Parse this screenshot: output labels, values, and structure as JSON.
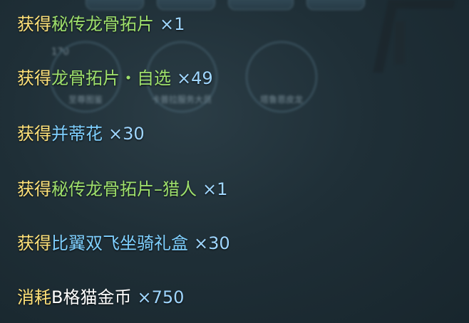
{
  "colors": {
    "verb": "#ffe27a",
    "item_green": "#9ee06c",
    "item_blue": "#7fd0ff",
    "quantity": "#9fd6ff"
  },
  "background": {
    "level_text": "170",
    "slots": [
      {
        "caption": "至尊图鉴"
      },
      {
        "caption": "卡普拉服务大员"
      },
      {
        "caption": "塔鲁恩皮龙"
      }
    ]
  },
  "log": [
    {
      "verb": "获得",
      "item": "秘传龙骨拓片",
      "quantity": "×1",
      "item_color": "green"
    },
    {
      "verb": "获得",
      "item": "龙骨拓片・自选",
      "quantity": "×49",
      "item_color": "green"
    },
    {
      "verb": "获得",
      "item": "并蒂花",
      "quantity": "×30",
      "item_color": "blue"
    },
    {
      "verb": "获得",
      "item": "秘传龙骨拓片–猎人",
      "quantity": "×1",
      "item_color": "green"
    },
    {
      "verb": "获得",
      "item": "比翼双飞坐骑礼盒",
      "quantity": "×30",
      "item_color": "blue"
    },
    {
      "verb": "消耗",
      "item": "B格猫金币",
      "quantity": "×750",
      "item_color": "white"
    }
  ]
}
